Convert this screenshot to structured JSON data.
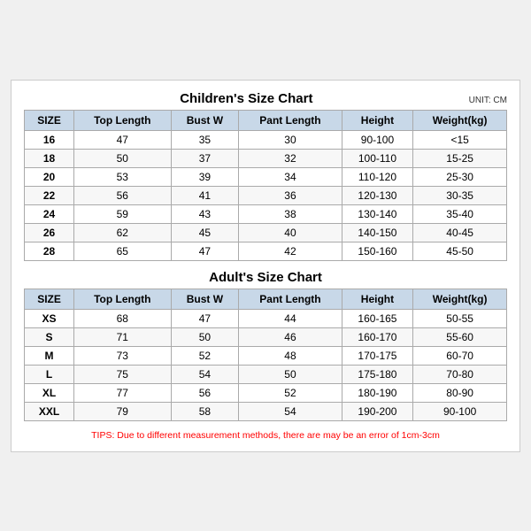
{
  "children_title": "Children's Size Chart",
  "adult_title": "Adult's Size Chart",
  "unit": "UNIT: CM",
  "children_headers": [
    "SIZE",
    "Top Length",
    "Bust W",
    "Pant Length",
    "Height",
    "Weight(kg)"
  ],
  "children_rows": [
    [
      "16",
      "47",
      "35",
      "30",
      "90-100",
      "<15"
    ],
    [
      "18",
      "50",
      "37",
      "32",
      "100-110",
      "15-25"
    ],
    [
      "20",
      "53",
      "39",
      "34",
      "110-120",
      "25-30"
    ],
    [
      "22",
      "56",
      "41",
      "36",
      "120-130",
      "30-35"
    ],
    [
      "24",
      "59",
      "43",
      "38",
      "130-140",
      "35-40"
    ],
    [
      "26",
      "62",
      "45",
      "40",
      "140-150",
      "40-45"
    ],
    [
      "28",
      "65",
      "47",
      "42",
      "150-160",
      "45-50"
    ]
  ],
  "adult_headers": [
    "SIZE",
    "Top Length",
    "Bust W",
    "Pant Length",
    "Height",
    "Weight(kg)"
  ],
  "adult_rows": [
    [
      "XS",
      "68",
      "47",
      "44",
      "160-165",
      "50-55"
    ],
    [
      "S",
      "71",
      "50",
      "46",
      "160-170",
      "55-60"
    ],
    [
      "M",
      "73",
      "52",
      "48",
      "170-175",
      "60-70"
    ],
    [
      "L",
      "75",
      "54",
      "50",
      "175-180",
      "70-80"
    ],
    [
      "XL",
      "77",
      "56",
      "52",
      "180-190",
      "80-90"
    ],
    [
      "XXL",
      "79",
      "58",
      "54",
      "190-200",
      "90-100"
    ]
  ],
  "tips": "TIPS: Due to different measurement methods, there are may be an error of 1cm-3cm"
}
